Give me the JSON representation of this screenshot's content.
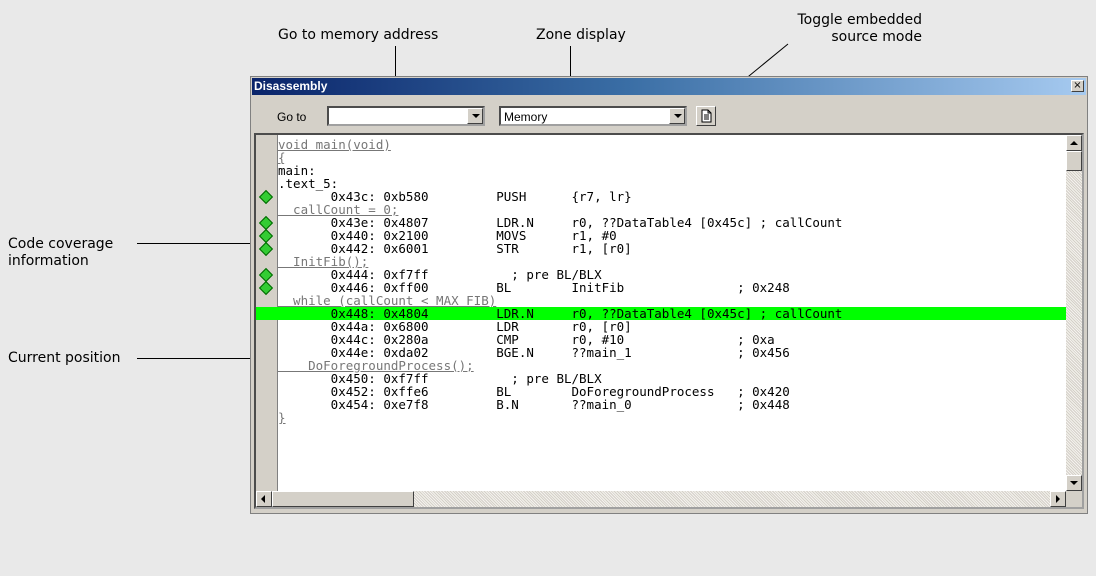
{
  "callouts": {
    "goto": "Go to memory address",
    "zone": "Zone display",
    "toggle": [
      "Toggle embedded",
      "source mode"
    ],
    "coverage": [
      "Code coverage",
      "information"
    ],
    "current": "Current position"
  },
  "window": {
    "title": "Disassembly",
    "close_glyph": "×"
  },
  "toolbar": {
    "goto_label": "Go to",
    "goto_value": "",
    "zone_value": "Memory",
    "toggle_icon": "source-document-icon"
  },
  "code_lines": [
    {
      "text": "void main(void)",
      "kind": "src",
      "marker": false
    },
    {
      "text": "{",
      "kind": "src",
      "marker": false
    },
    {
      "text": "main:",
      "kind": "label",
      "marker": false
    },
    {
      "text": ".text_5:",
      "kind": "label",
      "marker": false
    },
    {
      "text": "       0x43c: 0xb580         PUSH      {r7, lr}",
      "kind": "asm",
      "marker": true
    },
    {
      "text": "  callCount = 0;",
      "kind": "src",
      "marker": false
    },
    {
      "text": "       0x43e: 0x4807         LDR.N     r0, ??DataTable4 [0x45c] ; callCount",
      "kind": "asm",
      "marker": true
    },
    {
      "text": "       0x440: 0x2100         MOVS      r1, #0",
      "kind": "asm",
      "marker": true
    },
    {
      "text": "       0x442: 0x6001         STR       r1, [r0]",
      "kind": "asm",
      "marker": true
    },
    {
      "text": "  InitFib();",
      "kind": "src",
      "marker": false
    },
    {
      "text": "       0x444: 0xf7ff           ; pre BL/BLX",
      "kind": "asm",
      "marker": true
    },
    {
      "text": "       0x446: 0xff00         BL        InitFib               ; 0x248",
      "kind": "asm",
      "marker": true
    },
    {
      "text": "  while (callCount < MAX_FIB)",
      "kind": "src",
      "marker": false
    },
    {
      "text": "       0x448: 0x4804         LDR.N     r0, ??DataTable4 [0x45c] ; callCount",
      "kind": "current",
      "marker": false
    },
    {
      "text": "       0x44a: 0x6800         LDR       r0, [r0]",
      "kind": "asm",
      "marker": false
    },
    {
      "text": "       0x44c: 0x280a         CMP       r0, #10               ; 0xa",
      "kind": "asm",
      "marker": false
    },
    {
      "text": "       0x44e: 0xda02         BGE.N     ??main_1              ; 0x456",
      "kind": "asm",
      "marker": false
    },
    {
      "text": "    DoForegroundProcess();",
      "kind": "src",
      "marker": false
    },
    {
      "text": "       0x450: 0xf7ff           ; pre BL/BLX",
      "kind": "asm",
      "marker": false
    },
    {
      "text": "       0x452: 0xffe6         BL        DoForegroundProcess   ; 0x420",
      "kind": "asm",
      "marker": false
    },
    {
      "text": "       0x454: 0xe7f8         B.N       ??main_0              ; 0x448",
      "kind": "asm",
      "marker": false
    },
    {
      "text": "}",
      "kind": "src",
      "marker": false
    }
  ],
  "colors": {
    "current_line": "#00ff00",
    "coverage_marker": "#33cc33",
    "title_start": "#0a246a",
    "title_end": "#a6caf0"
  }
}
